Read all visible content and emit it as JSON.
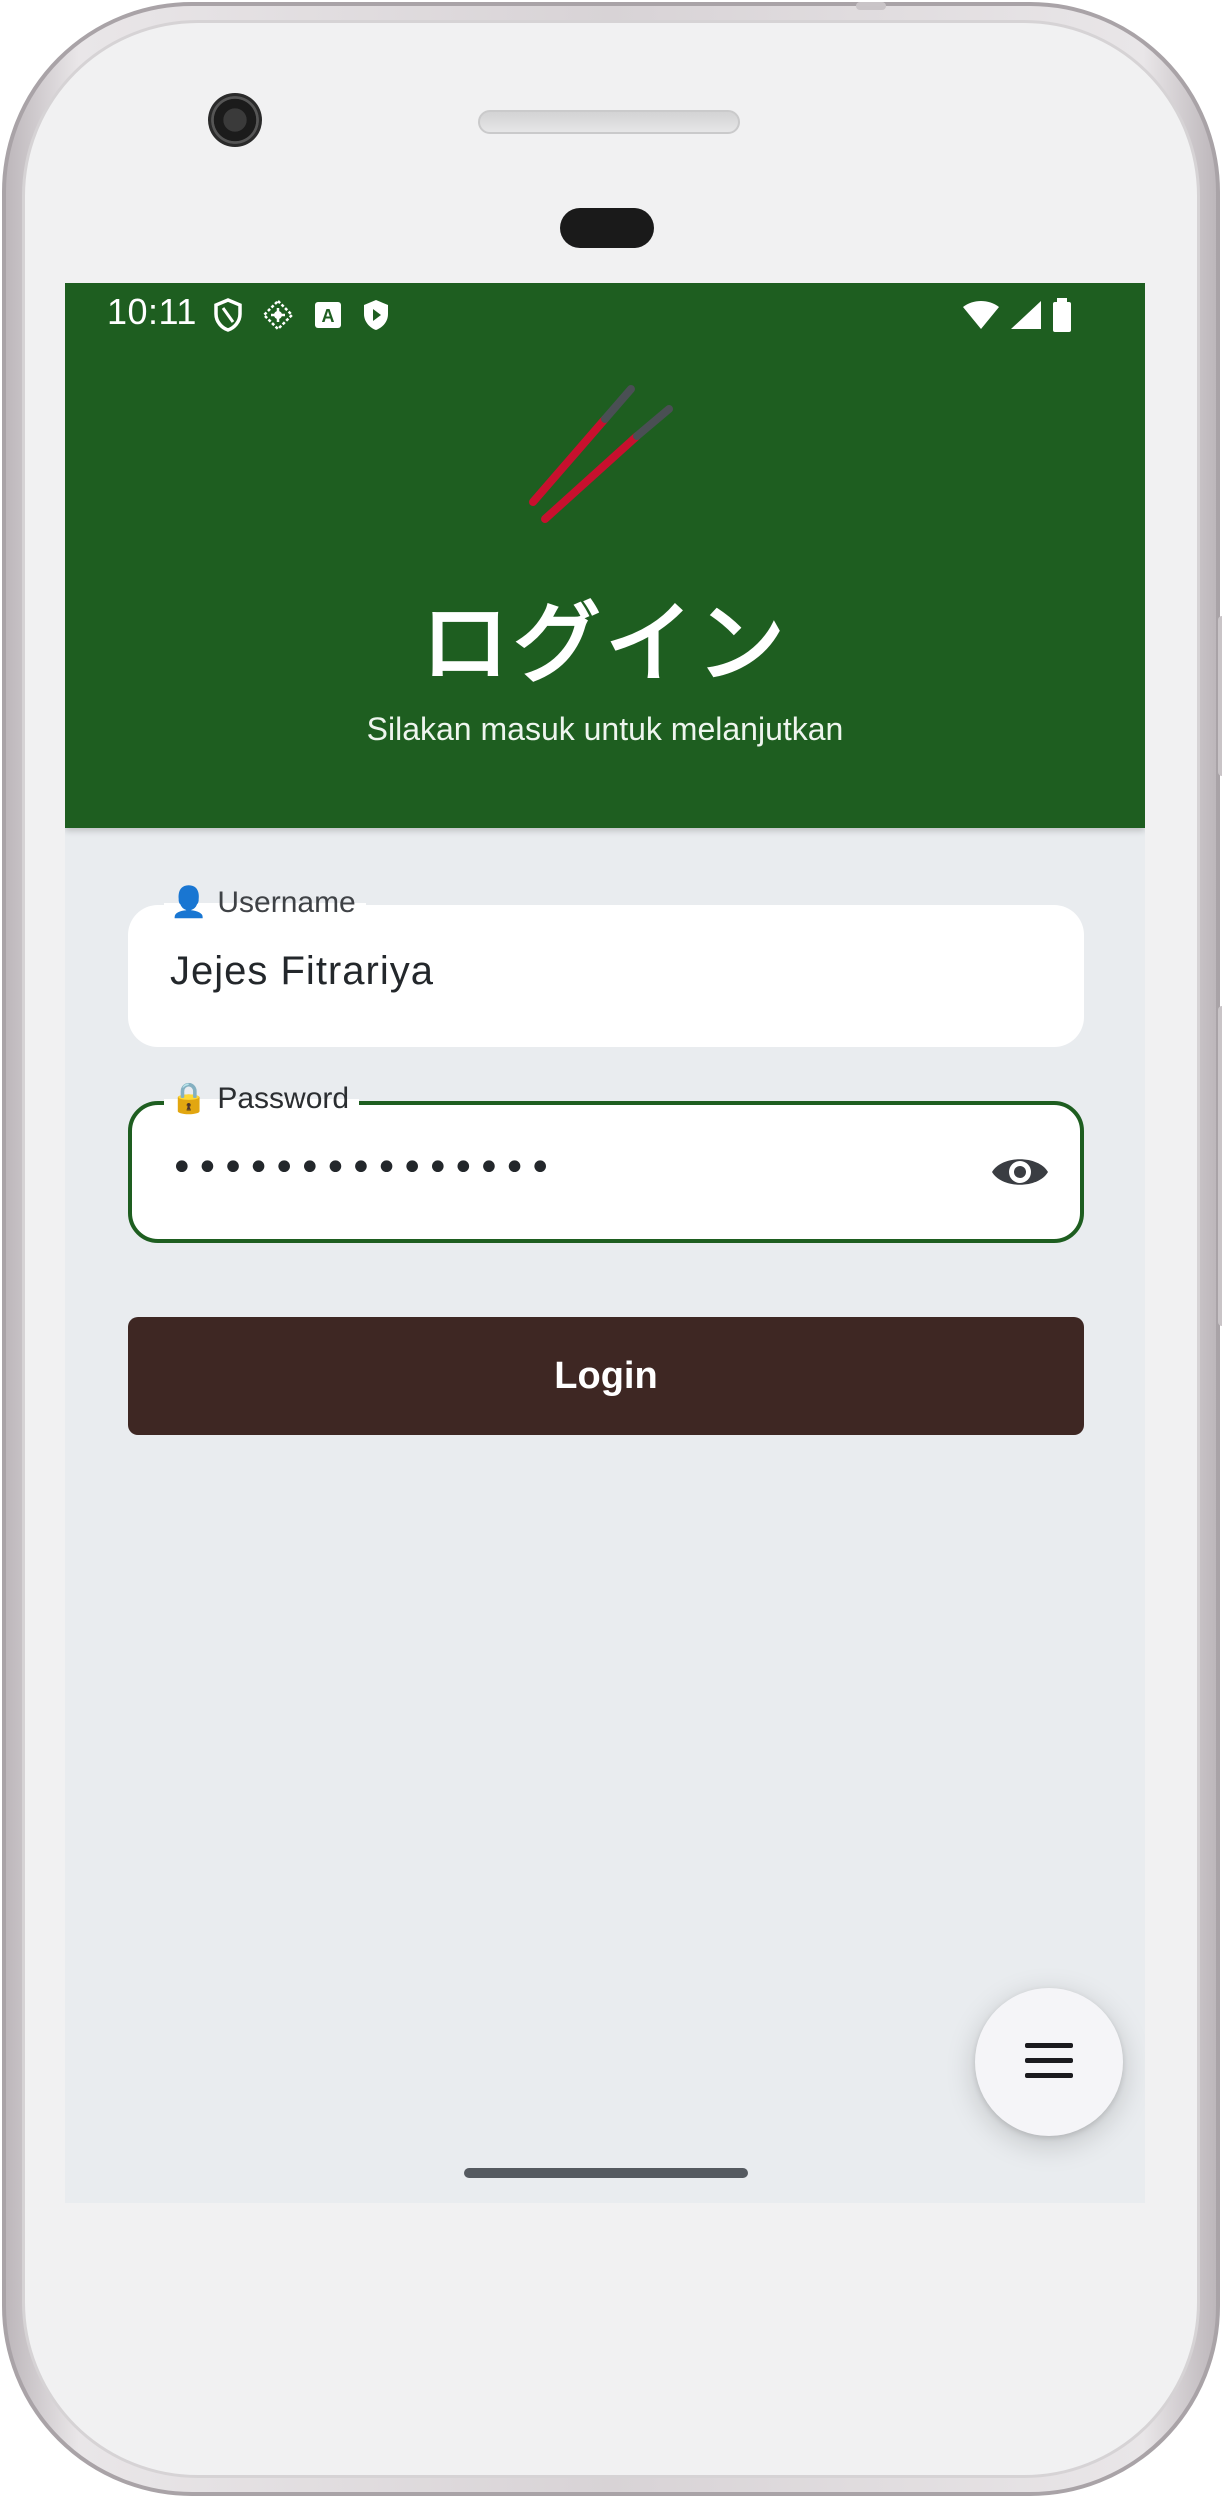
{
  "status_bar": {
    "time": "10:11",
    "left_icons": [
      "shield-outline-icon",
      "satellite-icon",
      "font-a-icon",
      "play-protect-icon"
    ],
    "right_icons": [
      "wifi-icon",
      "cellular-signal-icon",
      "battery-icon"
    ]
  },
  "header": {
    "logo_icon": "chopsticks-icon",
    "title": "ログイン",
    "subtitle": "Silakan masuk untuk melanjutkan",
    "background_color": "#1e5e20"
  },
  "form": {
    "username": {
      "label_icon": "👤",
      "label": "Username",
      "value": "Jejes Fitrariya"
    },
    "password": {
      "label_icon": "🔒",
      "label": "Password",
      "masked_value": "•••••••••••••••",
      "toggle_icon": "eye-icon",
      "focused": true
    },
    "login_button": {
      "label": "Login",
      "color": "#3e2723"
    }
  },
  "fab": {
    "icon": "menu-icon"
  }
}
